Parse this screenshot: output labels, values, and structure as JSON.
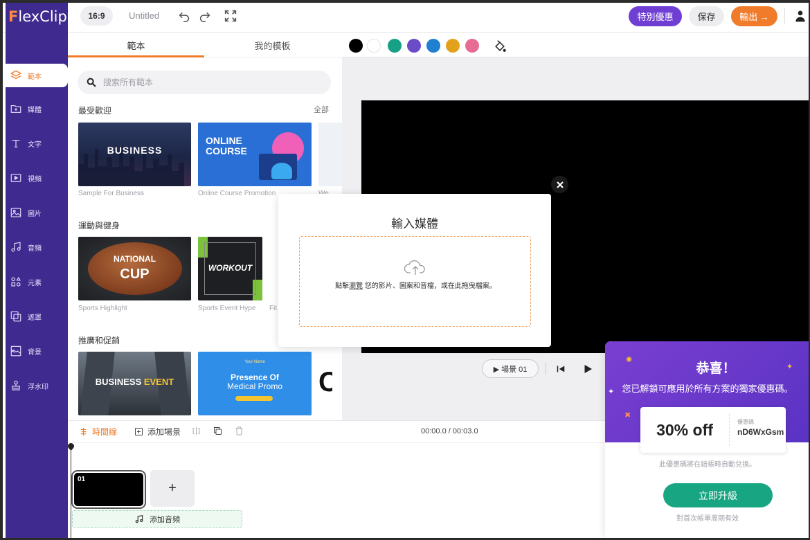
{
  "app": {
    "logo_initial": "F",
    "logo_rest": "lexClip"
  },
  "header": {
    "aspect_ratio": "16:9",
    "project_title": "Untitled",
    "special_offer_label": "特別優惠",
    "save_label": "保存",
    "export_label": "輸出 →"
  },
  "sidebar": {
    "items": [
      {
        "label": "範本",
        "icon": "layers-icon",
        "active": true
      },
      {
        "label": "媒體",
        "icon": "folder-plus-icon"
      },
      {
        "label": "文字",
        "icon": "text-icon"
      },
      {
        "label": "視頻",
        "icon": "video-icon"
      },
      {
        "label": "圖片",
        "icon": "image-icon"
      },
      {
        "label": "音頻",
        "icon": "music-icon"
      },
      {
        "label": "元素",
        "icon": "shapes-icon"
      },
      {
        "label": "遮罩",
        "icon": "overlay-icon"
      },
      {
        "label": "背景",
        "icon": "background-icon"
      },
      {
        "label": "浮水印",
        "icon": "stamp-icon"
      }
    ]
  },
  "panel": {
    "tabs": [
      {
        "label": "範本"
      },
      {
        "label": "我的模板"
      }
    ],
    "search_placeholder": "搜索所有範本",
    "see_all": "全部",
    "sections": [
      {
        "title": "最受歡迎",
        "items": [
          {
            "caption": "Sample For Business",
            "title": "BUSINESS"
          },
          {
            "caption": "Online Course Promotion",
            "title": "ONLINE COURSE"
          },
          {
            "caption": "We"
          }
        ]
      },
      {
        "title": "運動與健身",
        "items": [
          {
            "caption": "Sports Highlight",
            "title": "NATIONAL",
            "title2": "CUP"
          },
          {
            "caption": "Sports Event Hype",
            "title": "WORKOUT"
          },
          {
            "caption": "Fit"
          }
        ]
      },
      {
        "title": "推廣和促銷",
        "items": [
          {
            "title": "BUSINESS",
            "title2": "EVENT"
          },
          {
            "title": "Presence Of",
            "title2": "Medical Promo",
            "tag": "Your Name"
          },
          {
            "title": "C"
          }
        ]
      }
    ]
  },
  "colors": {
    "swatches": [
      "#000000",
      "#ffffff",
      "#16a085",
      "#6a4bc8",
      "#1f7fd0",
      "#e3a21c",
      "#e76b93"
    ],
    "accent": "#f07c2b",
    "sidebar_bg": "#3f2a8f"
  },
  "player": {
    "scene_label": "▶ 場景 01"
  },
  "timeline": {
    "timeline_label": "時間線",
    "add_scene_label": "添加場景",
    "time_display": "00:00.0 / 00:03.0",
    "clip_number": "01",
    "add_audio_label": "添加音頻"
  },
  "modal": {
    "title": "輸入媒體",
    "drop_text_prefix": "點擊",
    "drop_link": "瀏覽",
    "drop_text_suffix": " 您的影片、圖案和音檔，或在此拖曳檔案。"
  },
  "promo": {
    "title": "恭喜！",
    "subtitle": "您已解鎖可應用於所有方案的獨家優惠碼。",
    "discount": "30% off",
    "code_label": "優惠碼",
    "code": "nD6WxGsm",
    "note": "此優惠碼將在結帳時自動兌換。",
    "upgrade_label": "立即升級",
    "footnote": "對首次帳單周期有效"
  }
}
